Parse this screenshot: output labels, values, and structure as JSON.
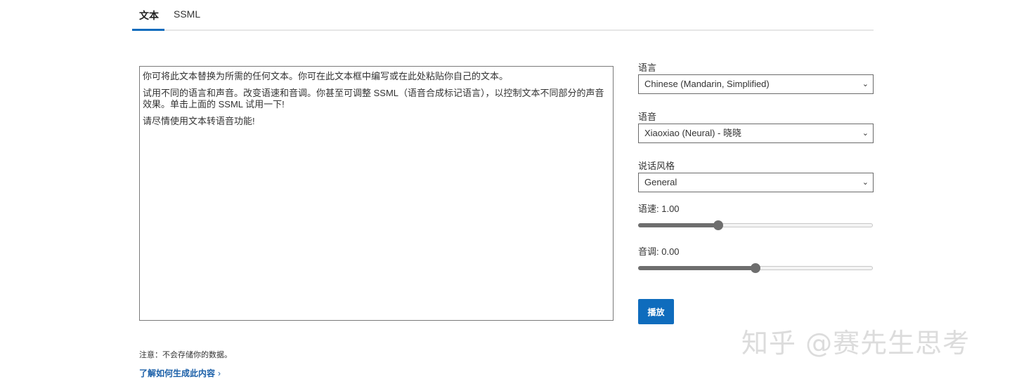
{
  "tabs": [
    {
      "label": "文本",
      "active": true
    },
    {
      "label": "SSML",
      "active": false
    }
  ],
  "editor": {
    "paragraphs": [
      "你可将此文本替换为所需的任何文本。你可在此文本框中编写或在此处粘贴你自己的文本。",
      "试用不同的语言和声音。改变语速和音调。你甚至可调整 SSML（语音合成标记语言），以控制文本不同部分的声音效果。单击上面的 SSML 试用一下!",
      "请尽情使用文本转语音功能!"
    ]
  },
  "language": {
    "label": "语言",
    "value": "Chinese (Mandarin, Simplified)"
  },
  "voice": {
    "label": "语音",
    "value": "Xiaoxiao (Neural) - 晓晓"
  },
  "style": {
    "label": "说话风格",
    "value": "General"
  },
  "rate": {
    "label": "语速: 1.00",
    "level": 0.34
  },
  "pitch": {
    "label": "音调: 0.00",
    "level": 0.5
  },
  "play_button": {
    "label": "播放"
  },
  "note": "注意：不会存储你的数据。",
  "learn_link": {
    "label": "了解如何生成此内容",
    "icon": "chevron-right-icon"
  },
  "watermark": "知乎 @赛先生思考",
  "colors": {
    "accent": "#0f6cbd",
    "link": "#1a5fa8"
  }
}
